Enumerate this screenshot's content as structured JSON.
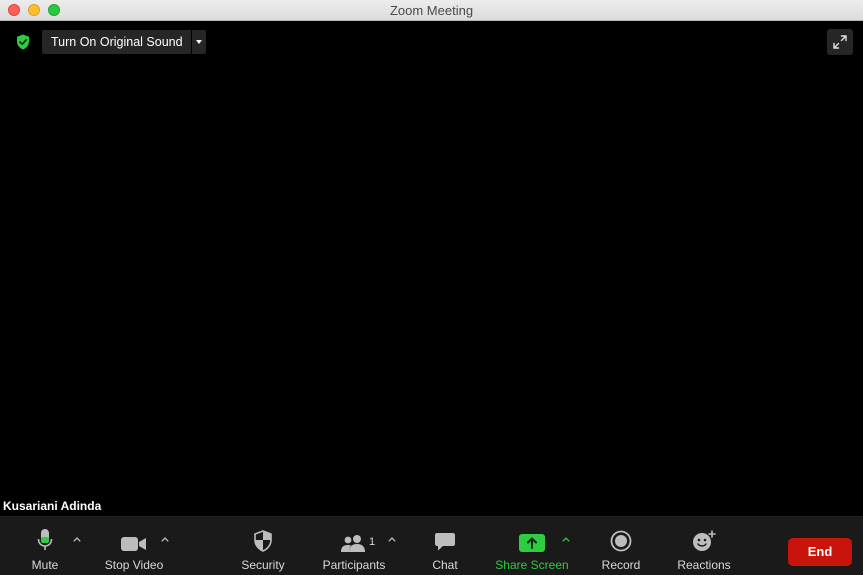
{
  "window": {
    "title": "Zoom Meeting"
  },
  "overlay": {
    "sound_button_label": "Turn On Original Sound",
    "participant_name": "Kusariani Adinda"
  },
  "toolbar": {
    "mute_label": "Mute",
    "stop_video_label": "Stop Video",
    "security_label": "Security",
    "participants_label": "Participants",
    "participants_count": "1",
    "chat_label": "Chat",
    "share_screen_label": "Share Screen",
    "record_label": "Record",
    "reactions_label": "Reactions",
    "end_label": "End"
  },
  "colors": {
    "share_green": "#2ecc40",
    "end_red": "#c9140c",
    "shield_green": "#2ecc40",
    "mic_green": "#2ecc40"
  }
}
